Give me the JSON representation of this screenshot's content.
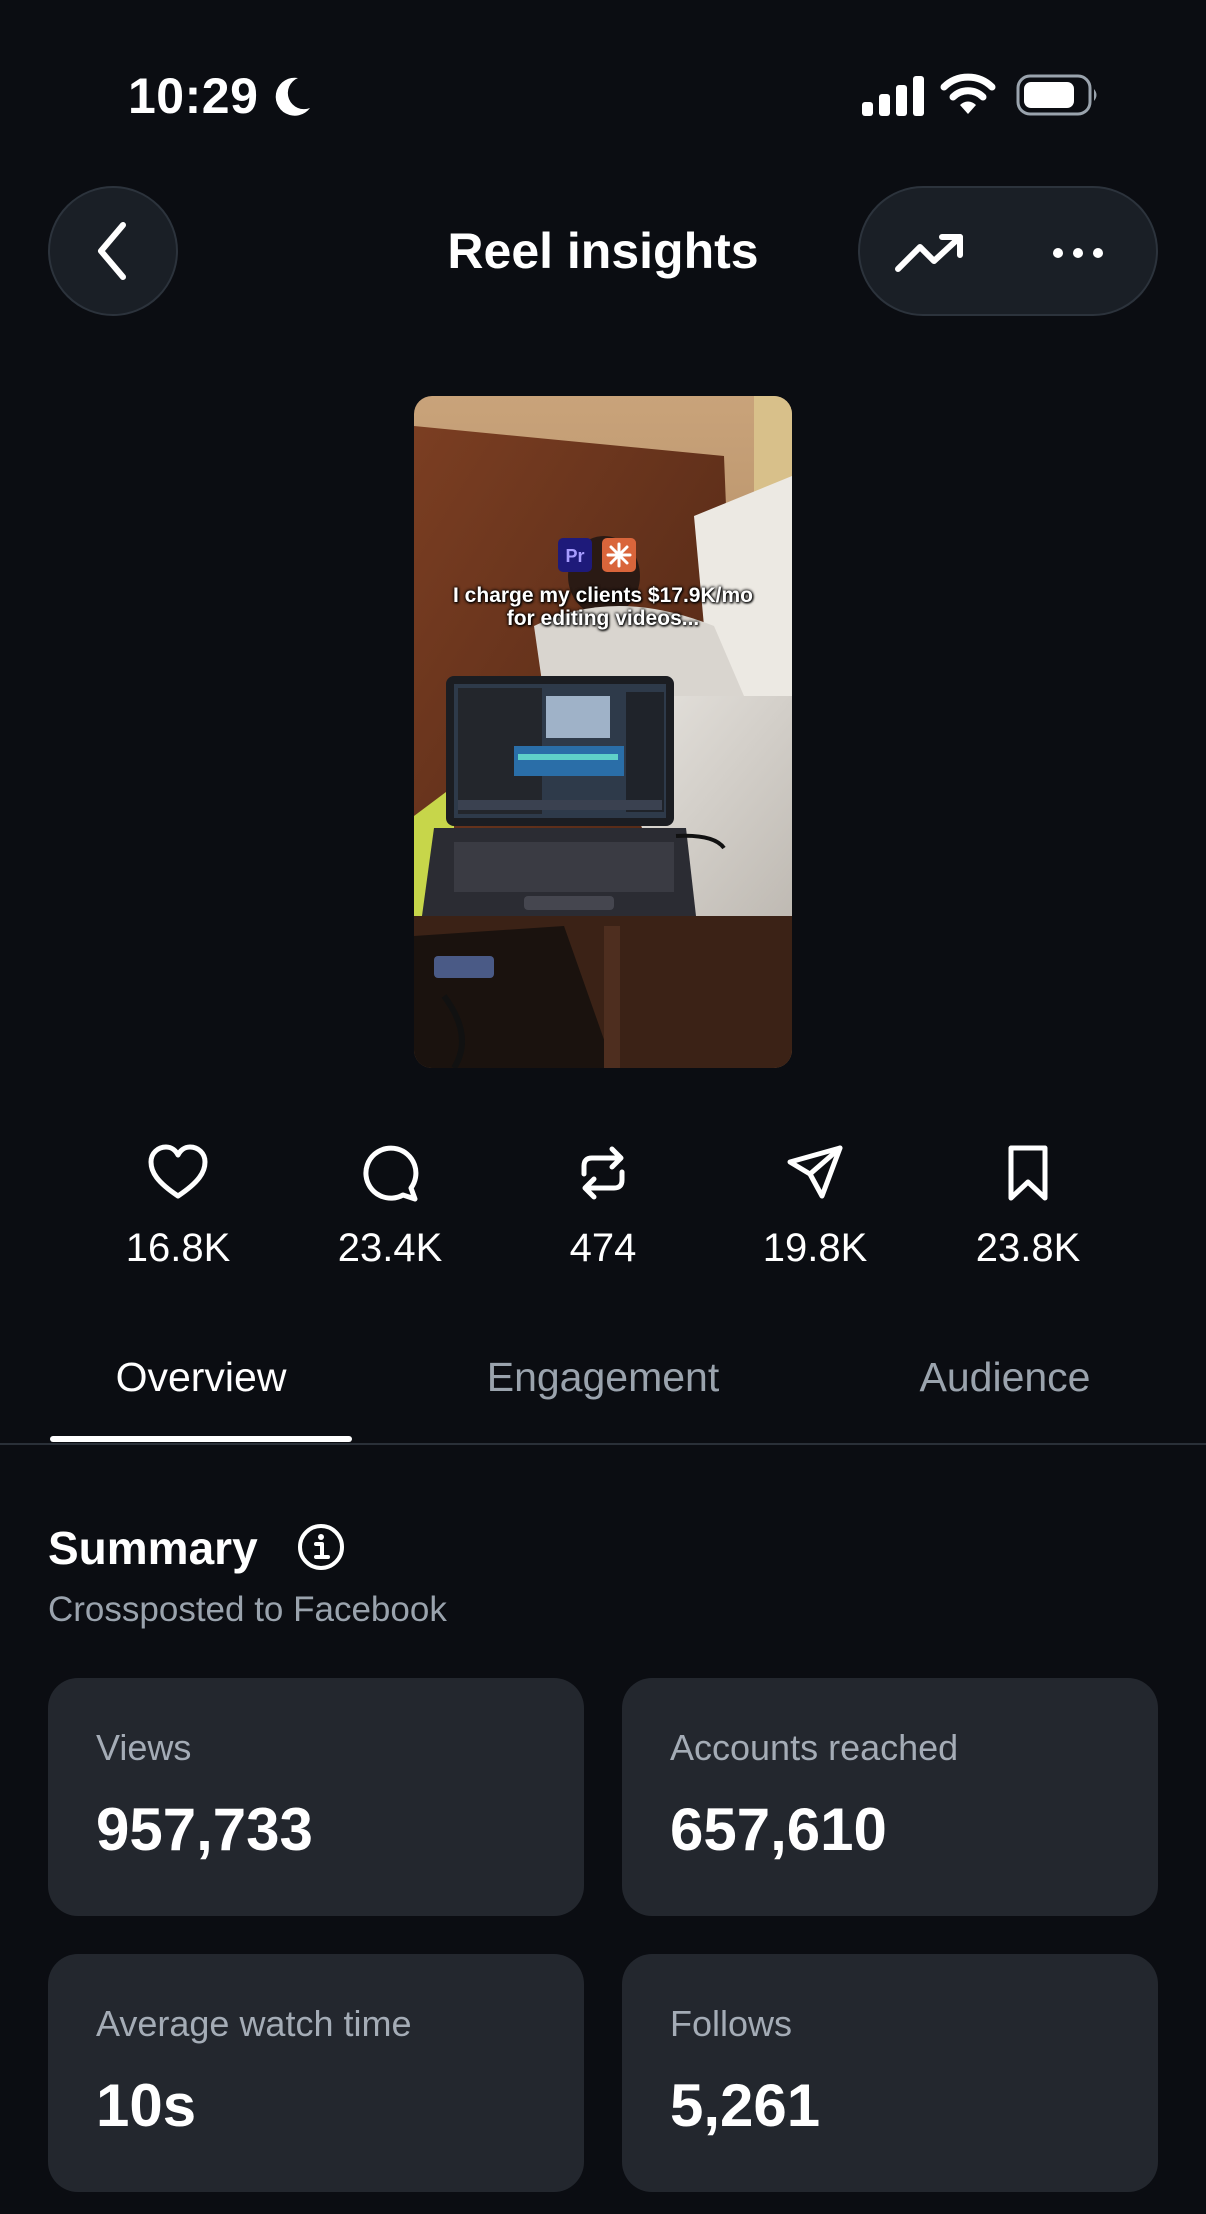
{
  "status_bar": {
    "time": "10:29",
    "icons": [
      "moon-icon",
      "signal-icon",
      "wifi-icon",
      "battery-icon"
    ]
  },
  "header": {
    "title": "Reel insights",
    "back_icon": "chevron-left-icon",
    "actions": [
      "trend-up-icon",
      "more-dots-icon"
    ]
  },
  "reel": {
    "caption_line1": "I charge my clients $17.9K/mo",
    "caption_line2": "for editing videos..."
  },
  "stats": [
    {
      "icon": "heart-icon",
      "value": "16.8K"
    },
    {
      "icon": "comment-icon",
      "value": "23.4K"
    },
    {
      "icon": "repost-icon",
      "value": "474"
    },
    {
      "icon": "share-icon",
      "value": "19.8K"
    },
    {
      "icon": "bookmark-icon",
      "value": "23.8K"
    }
  ],
  "tabs": [
    {
      "label": "Overview",
      "active": true
    },
    {
      "label": "Engagement",
      "active": false
    },
    {
      "label": "Audience",
      "active": false
    }
  ],
  "summary": {
    "title": "Summary",
    "subtitle": "Crossposted to Facebook",
    "cards": [
      {
        "label": "Views",
        "value": "957,733"
      },
      {
        "label": "Accounts reached",
        "value": "657,610"
      },
      {
        "label": "Average watch time",
        "value": "10s"
      },
      {
        "label": "Follows",
        "value": "5,261"
      }
    ]
  },
  "colors": {
    "background": "#0b0d12",
    "card": "#23272e",
    "muted_text": "#9aa3ad",
    "text": "#ffffff"
  }
}
